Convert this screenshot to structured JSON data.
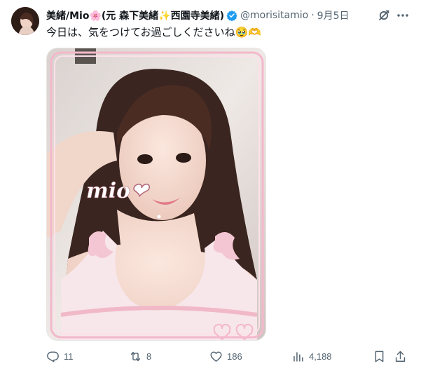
{
  "post": {
    "author_name": "美緒/Mio🌸(元 森下美緒✨西園寺美緒)",
    "handle": "@morisitamio",
    "separator": "·",
    "date": "9月5日",
    "text": "今日は、気をつけてお過ごしくださいね🥹🫶",
    "image_overlay_text": "mio❤"
  },
  "actions": {
    "replies": "11",
    "reposts": "8",
    "likes": "186",
    "views": "4,188"
  },
  "colors": {
    "text": "#0f1419",
    "muted": "#536471",
    "verified": "#1d9bf0",
    "frame_pink": "#f4b8cc"
  },
  "icons": {
    "verified": "verified-badge-icon",
    "grok": "grok-icon",
    "more": "more-icon",
    "reply": "reply-icon",
    "repost": "repost-icon",
    "like": "heart-icon",
    "views": "views-chart-icon",
    "bookmark": "bookmark-icon",
    "share": "share-icon"
  }
}
